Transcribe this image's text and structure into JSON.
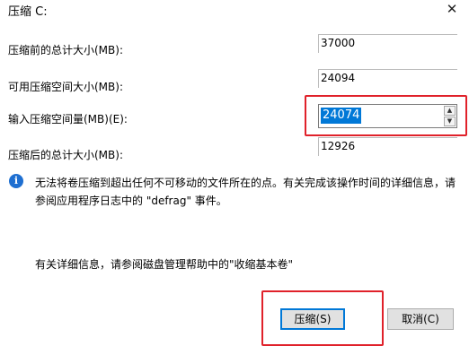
{
  "window": {
    "title": "压缩 C:",
    "close_glyph": "✕"
  },
  "fields": {
    "total_before_label": "压缩前的总计大小(MB):",
    "total_before_value": "37000",
    "available_label": "可用压缩空间大小(MB):",
    "available_value": "24094",
    "shrink_amount_label": "输入压缩空间量(MB)(E):",
    "shrink_amount_value": "24074",
    "total_after_label": "压缩后的总计大小(MB):",
    "total_after_value": "12926"
  },
  "spinner": {
    "up_glyph": "▲",
    "down_glyph": "▼"
  },
  "info": {
    "icon_glyph": "i",
    "message": "无法将卷压缩到超出任何不可移动的文件所在的点。有关完成该操作时间的详细信息，请参阅应用程序日志中的 \"defrag\" 事件。",
    "help_text": "有关详细信息，请参阅磁盘管理帮助中的\"收缩基本卷\""
  },
  "buttons": {
    "shrink_label": "压缩(S)",
    "cancel_label": "取消(C)"
  },
  "colors": {
    "highlight_box": "#e0212a",
    "selection": "#0078d7",
    "info_icon": "#1e6fd1"
  },
  "icons": {
    "info": "info-icon",
    "close": "close-icon",
    "spin_up": "spin-up-icon",
    "spin_down": "spin-down-icon"
  }
}
